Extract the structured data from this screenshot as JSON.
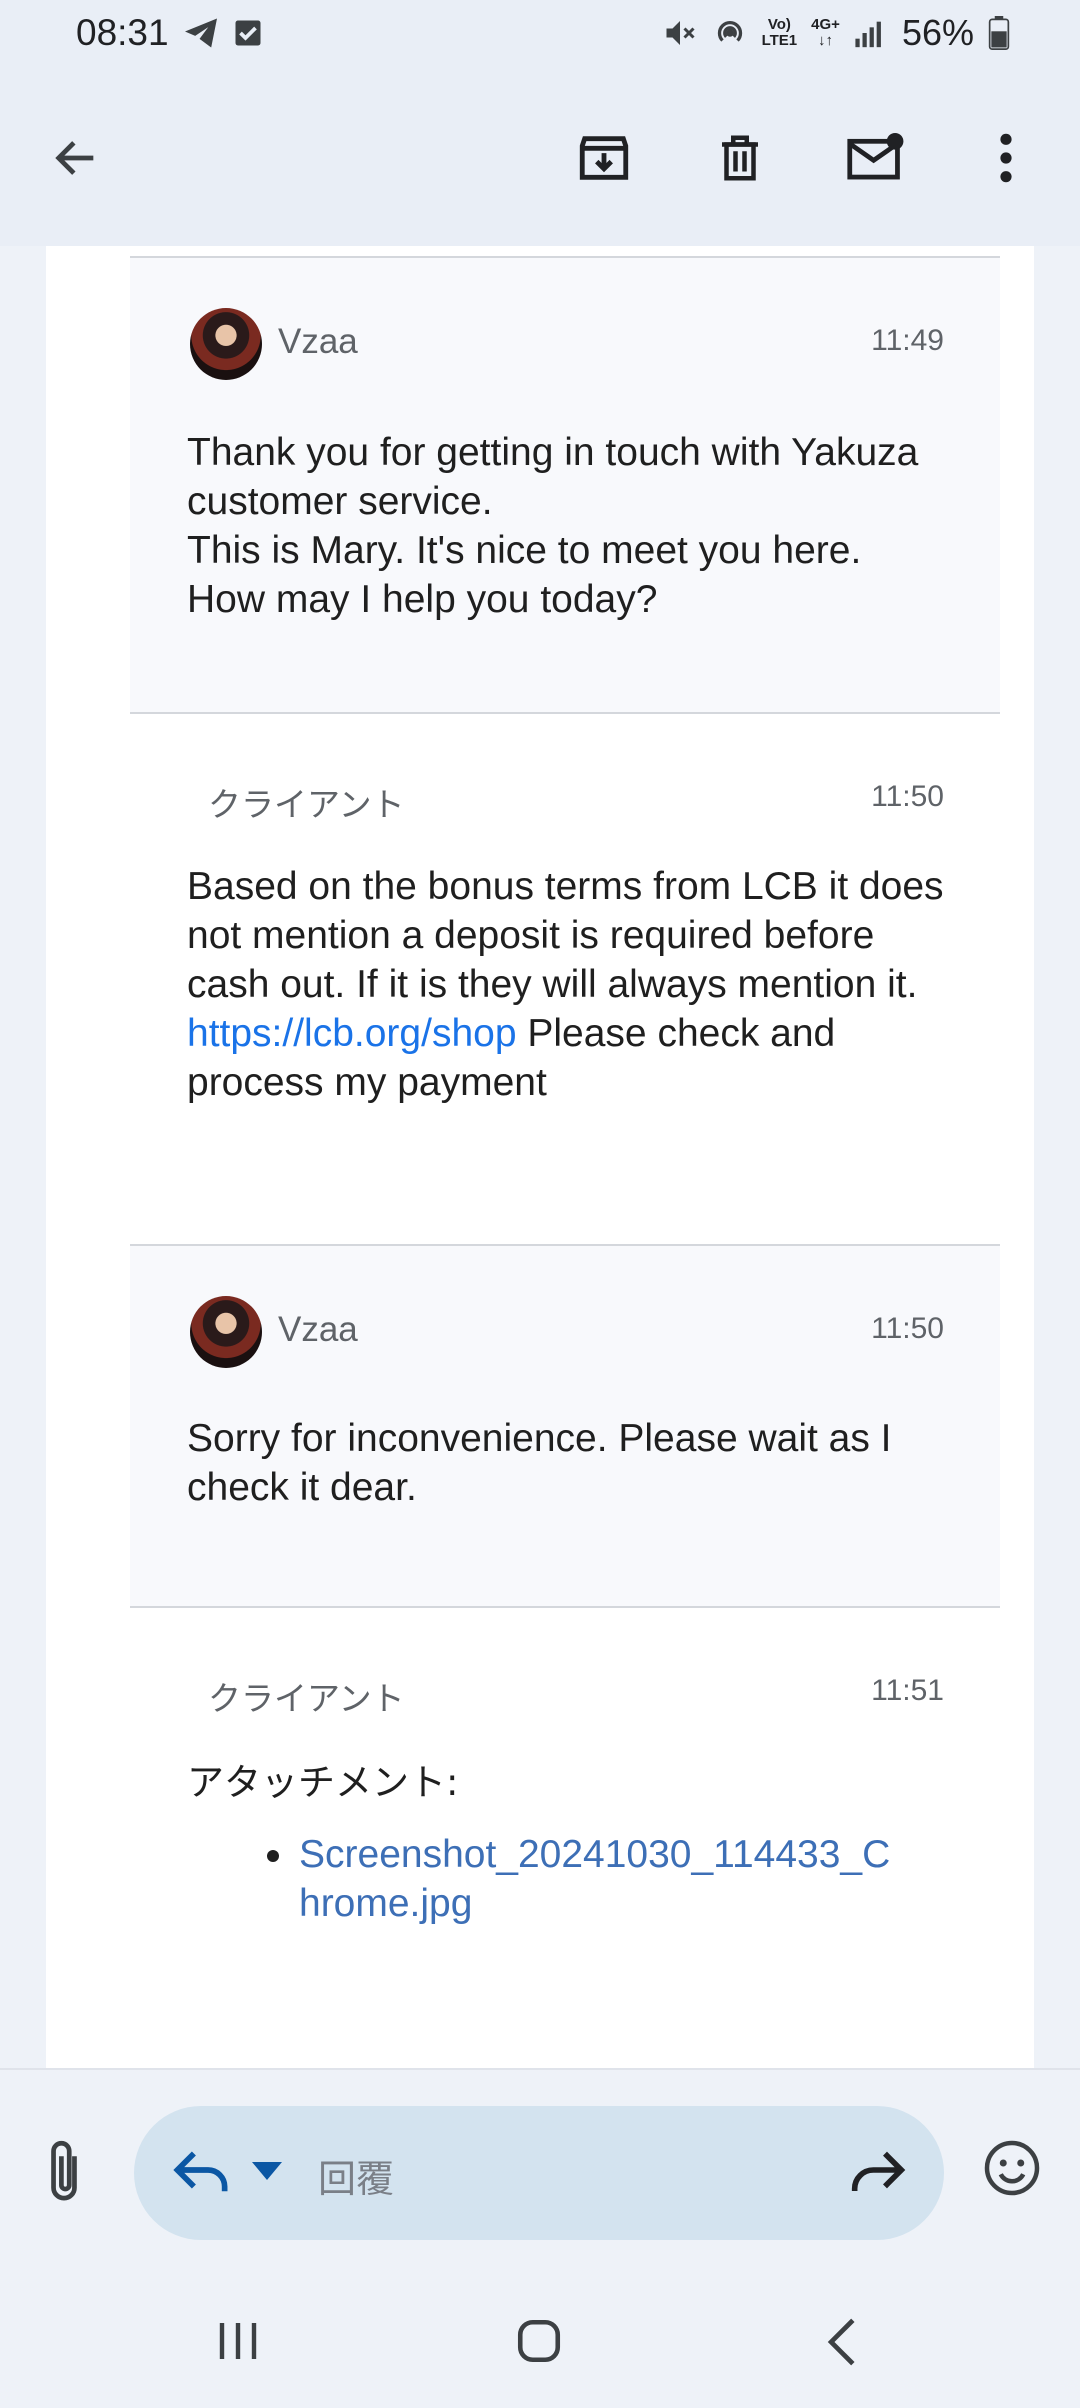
{
  "status_bar": {
    "time": "08:31",
    "battery": "56%",
    "network_top": "Vo)",
    "network_bottom": "LTE1",
    "network_type": "4G+",
    "icons": [
      "telegram-icon",
      "check-square-icon",
      "mute-icon",
      "hotspot-icon",
      "signal-icon",
      "battery-icon"
    ]
  },
  "toolbar": {
    "back": "arrow-left-icon",
    "actions": [
      "archive-icon",
      "delete-icon",
      "mark-unread-icon",
      "more-vert-icon"
    ]
  },
  "messages": [
    {
      "role": "agent",
      "sender": "Vzaa",
      "time": "11:49",
      "lines": [
        "Thank you for getting in touch with Yakuza customer service.",
        "This is Mary. It's nice to meet you here. How may I help you today?"
      ]
    },
    {
      "role": "client",
      "sender": "クライアント",
      "time": "11:50",
      "text_before": "Based on the bonus terms from LCB it does not mention a deposit is required before cash out. If it is they will always mention it.",
      "link": "https://lcb.org/shop",
      "text_after": " Please check and process my payment"
    },
    {
      "role": "agent",
      "sender": "Vzaa",
      "time": "11:50",
      "lines": [
        "Sorry for inconvenience. Please wait as I check it dear."
      ]
    },
    {
      "role": "client",
      "sender": "クライアント",
      "time": "11:51",
      "attachments_label": "アタッチメント:",
      "attachment": "Screenshot_20241030_114433_Chrome.jpg"
    }
  ],
  "compose": {
    "placeholder": "回覆",
    "icons": [
      "attach-icon",
      "reply-icon",
      "dropdown-icon",
      "forward-icon",
      "emoji-icon"
    ]
  },
  "nav": {
    "icons": [
      "recents-icon",
      "home-icon",
      "back-icon"
    ]
  },
  "colors": {
    "accent_link": "#1a73e8",
    "attachment_link": "#3d6fb6",
    "bar_bg": "#e9eef6",
    "pill_bg": "#d3e3ef"
  }
}
